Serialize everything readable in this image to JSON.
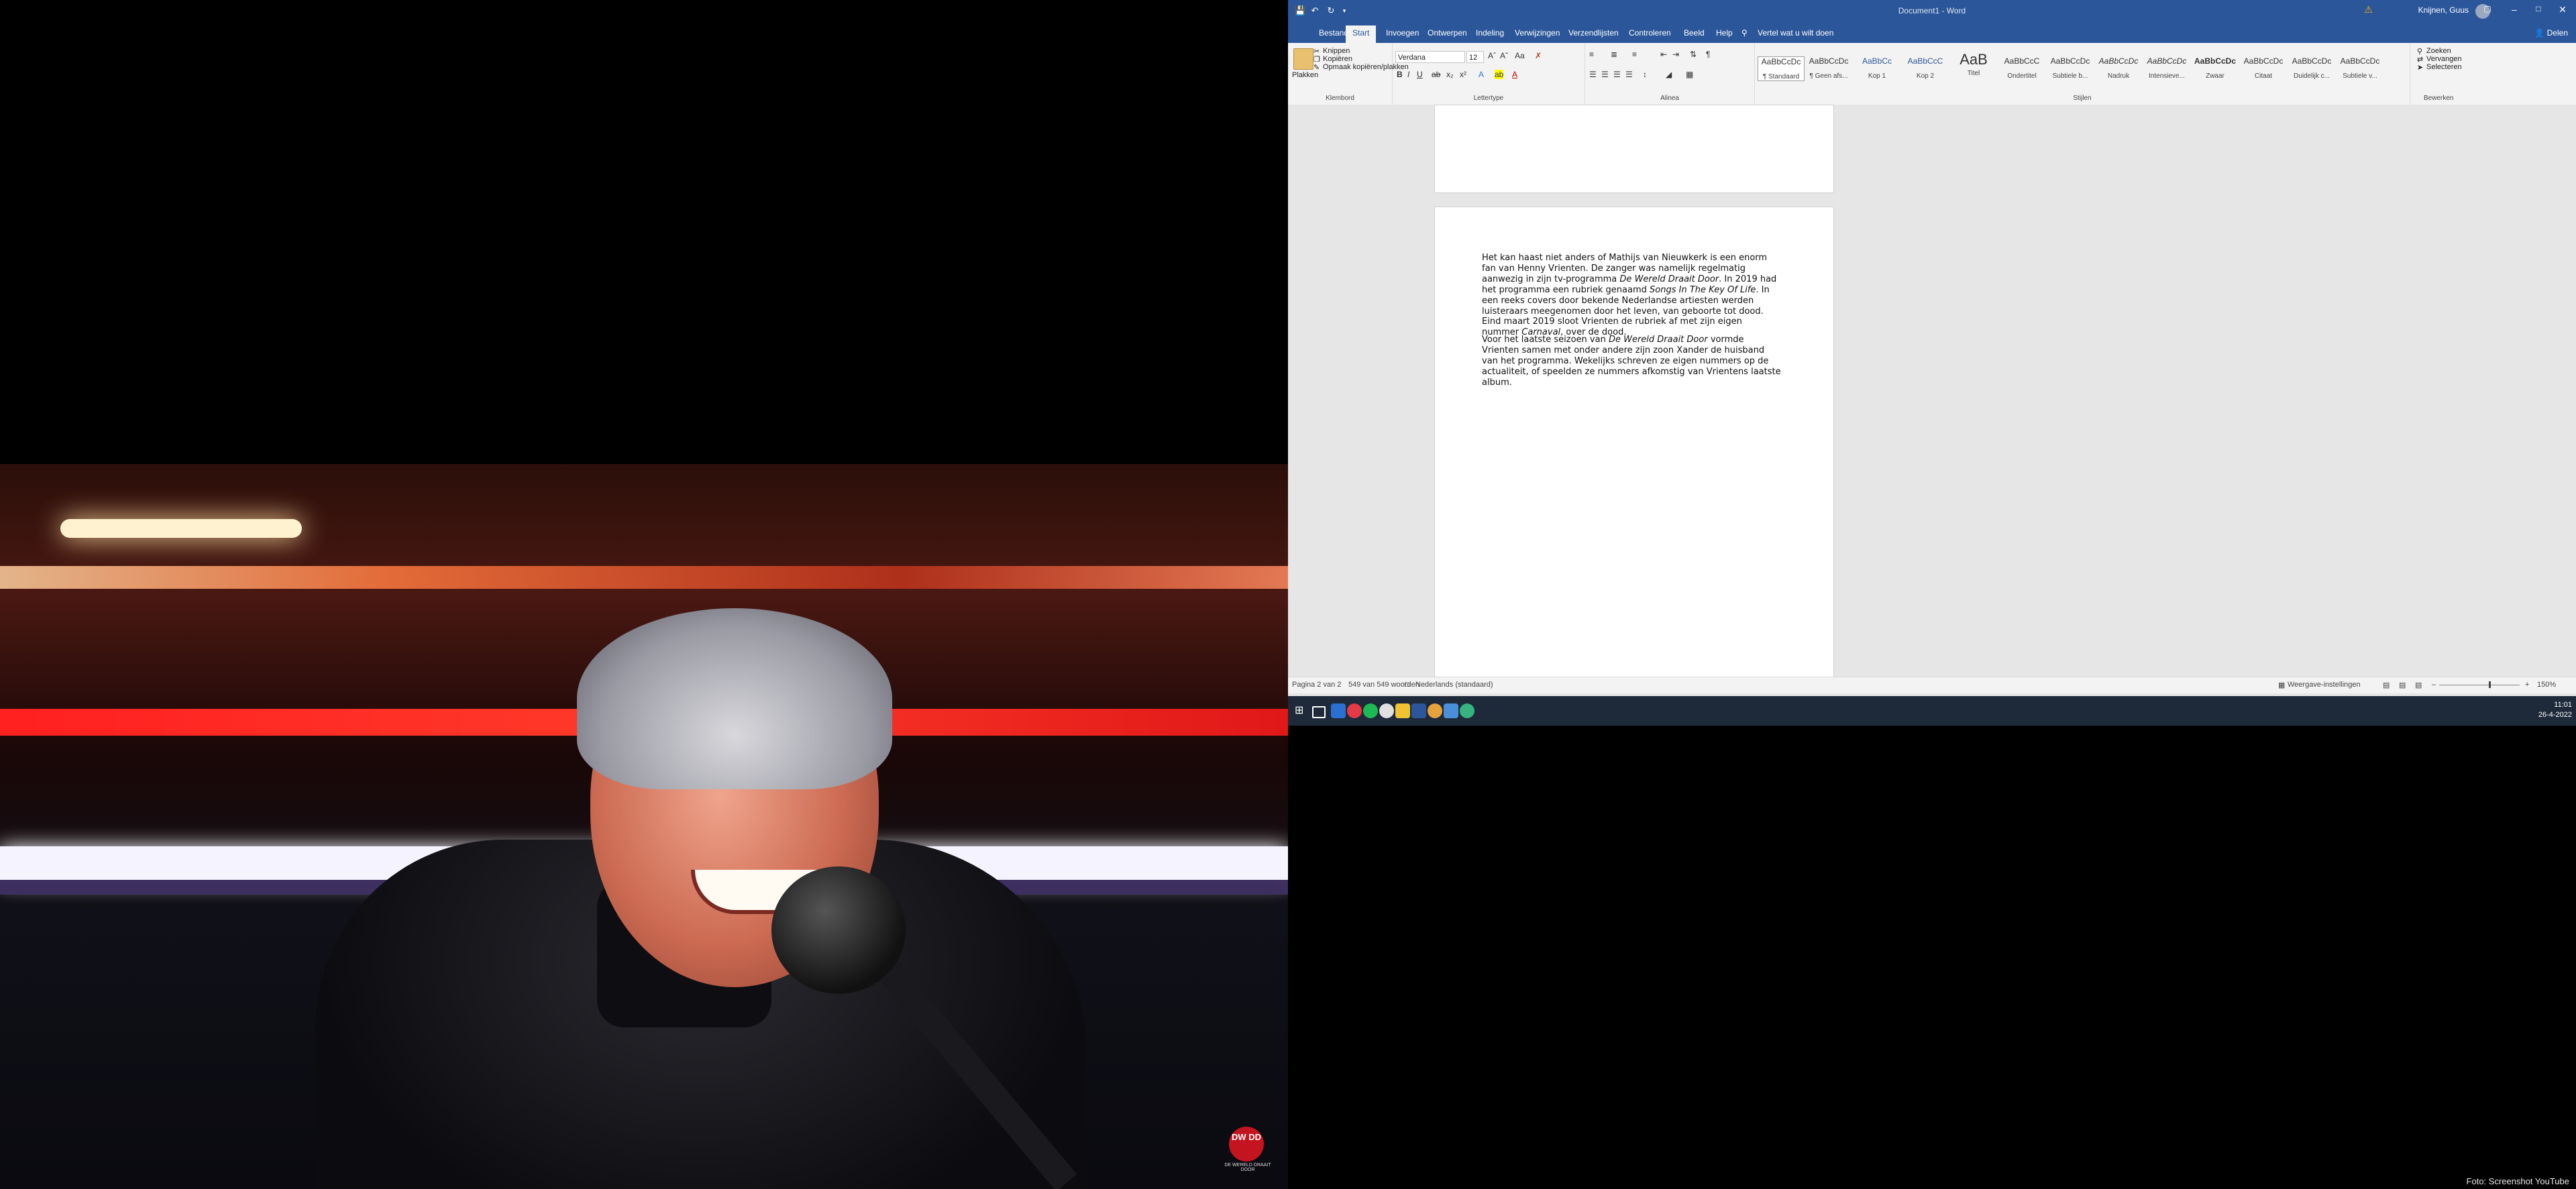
{
  "word": {
    "title": "Document1 - Word",
    "user": "Knijnen, Guus",
    "tabs": [
      "Bestand",
      "Start",
      "Invoegen",
      "Ontwerpen",
      "Indeling",
      "Verwijzingen",
      "Verzendlijsten",
      "Controleren",
      "Beeld",
      "Help"
    ],
    "tell_me": "Vertel wat u wilt doen",
    "share": "Delen",
    "clipboard": {
      "paste": "Plakken",
      "cut": "Knippen",
      "copy": "Kopiëren",
      "format_painter": "Opmaak kopiëren/plakken",
      "label": "Klembord"
    },
    "font": {
      "name": "Verdana",
      "size": "12",
      "label": "Lettertype"
    },
    "paragraph_label": "Alinea",
    "styles": {
      "label": "Stijlen",
      "items": [
        {
          "preview": "AaBbCcDc",
          "name": "¶ Standaard"
        },
        {
          "preview": "AaBbCcDc",
          "name": "¶ Geen afs..."
        },
        {
          "preview": "AaBbCc",
          "name": "Kop 1"
        },
        {
          "preview": "AaBbCcC",
          "name": "Kop 2"
        },
        {
          "preview": "AaB",
          "name": "Titel"
        },
        {
          "preview": "AaBbCcC",
          "name": "Ondertitel"
        },
        {
          "preview": "AaBbCcDc",
          "name": "Subtiele b..."
        },
        {
          "preview": "AaBbCcDc",
          "name": "Nadruk"
        },
        {
          "preview": "AaBbCcDc",
          "name": "Intensieve..."
        },
        {
          "preview": "AaBbCcDc",
          "name": "Zwaar"
        },
        {
          "preview": "AaBbCcDc",
          "name": "Citaat"
        },
        {
          "preview": "AaBbCcDc",
          "name": "Duidelijk c..."
        },
        {
          "preview": "AaBbCcDc",
          "name": "Subtiele v..."
        }
      ]
    },
    "editing": {
      "find": "Zoeken",
      "replace": "Vervangen",
      "select": "Selecteren",
      "label": "Bewerken"
    },
    "document": {
      "para1": {
        "t1": "Het kan haast niet anders of Mathijs van Nieuwkerk is een enorm fan van Henny Vrienten. De zanger was namelijk regelmatig aanwezig in zijn tv-programma ",
        "i1": "De Wereld Draait Door",
        "t2": ". In 2019 had het programma een rubriek genaamd ",
        "i2": "Songs In The Key Of Life",
        "t3": ". In een reeks covers door bekende Nederlandse artiesten werden luisteraars meegenomen door het leven, van geboorte tot dood. Eind maart 2019 sloot Vrienten de rubriek af met zijn eigen nummer ",
        "i3": "Carnaval",
        "t4": ", over de dood."
      },
      "para2": {
        "t1": "Voor het laatste seizoen van ",
        "i1": "De Wereld Draait Door",
        "t2": " vormde Vrienten samen met onder andere zijn zoon Xander de huisband van het programma. Wekelijks schreven ze eigen nummers op de actualiteit, of speelden ze nummers afkomstig van Vrientens laatste album."
      }
    },
    "status": {
      "page": "Pagina 2 van 2",
      "words": "549 van 549 woorden",
      "language": "Nederlands (standaard)",
      "display_settings": "Weergave-instellingen",
      "zoom": "150%"
    }
  },
  "taskbar": {
    "time": "11:01",
    "date": "26-4-2022"
  },
  "video": {
    "logo": "DW DD",
    "logo_sub": "DE WERELD DRAAIT DOOR"
  },
  "caption": "Foto: Screenshot YouTube"
}
